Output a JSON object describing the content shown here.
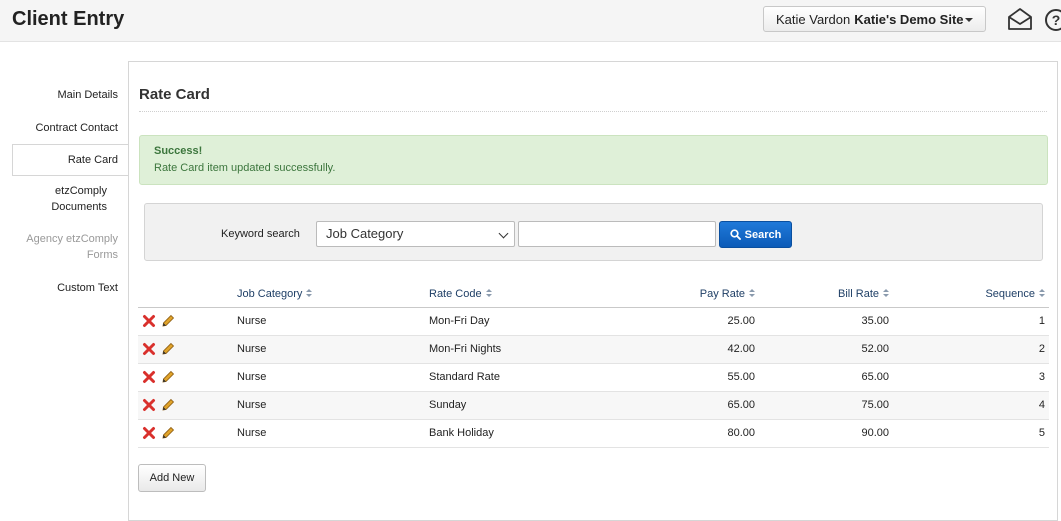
{
  "header": {
    "title": "Client Entry",
    "user_name": "Katie Vardon",
    "site_name": "Katie's Demo Site",
    "help_symbol": "?"
  },
  "sidebar": {
    "items": [
      {
        "label": "Main Details",
        "state": "normal"
      },
      {
        "label": "Contract Contact",
        "state": "normal"
      },
      {
        "label": "Rate Card",
        "state": "active"
      },
      {
        "label": "etzComply Documents",
        "state": "normal"
      },
      {
        "label": "Agency etzComply Forms",
        "state": "disabled"
      },
      {
        "label": "Custom Text",
        "state": "normal"
      }
    ]
  },
  "panel": {
    "title": "Rate Card"
  },
  "alert": {
    "heading": "Success!",
    "message": "Rate Card item updated successfully."
  },
  "search": {
    "label": "Keyword search",
    "field_selected": "Job Category",
    "keyword_value": "",
    "button_label": "Search"
  },
  "table": {
    "columns": [
      "Job Category",
      "Rate Code",
      "Pay Rate",
      "Bill Rate",
      "Sequence"
    ],
    "rows": [
      {
        "job_category": "Nurse",
        "rate_code": "Mon-Fri Day",
        "pay_rate": "25.00",
        "bill_rate": "35.00",
        "sequence": "1"
      },
      {
        "job_category": "Nurse",
        "rate_code": "Mon-Fri Nights",
        "pay_rate": "42.00",
        "bill_rate": "52.00",
        "sequence": "2"
      },
      {
        "job_category": "Nurse",
        "rate_code": "Standard Rate",
        "pay_rate": "55.00",
        "bill_rate": "65.00",
        "sequence": "3"
      },
      {
        "job_category": "Nurse",
        "rate_code": "Sunday",
        "pay_rate": "65.00",
        "bill_rate": "75.00",
        "sequence": "4"
      },
      {
        "job_category": "Nurse",
        "rate_code": "Bank Holiday",
        "pay_rate": "80.00",
        "bill_rate": "90.00",
        "sequence": "5"
      }
    ]
  },
  "actions": {
    "add_new_label": "Add New"
  },
  "colors": {
    "success_bg": "#dff0d8",
    "success_text": "#3c763d",
    "primary_button": "#1466c8",
    "delete_icon": "#d9302c",
    "edit_icon": "#e0a32a"
  },
  "icons": {
    "row_delete": "close-icon",
    "row_edit": "pencil-icon",
    "search": "magnifier-icon",
    "header_mail": "envelope-icon",
    "header_help": "help-icon"
  }
}
